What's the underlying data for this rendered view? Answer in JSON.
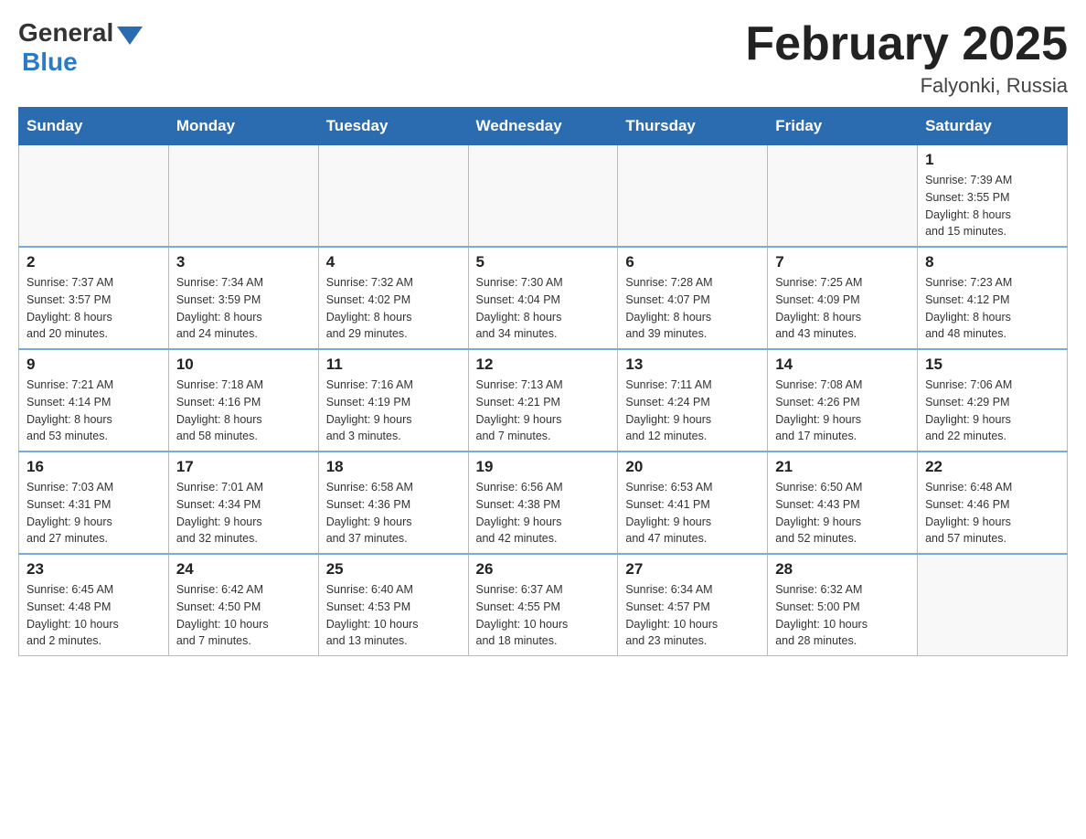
{
  "logo": {
    "general": "General",
    "blue": "Blue"
  },
  "title": "February 2025",
  "subtitle": "Falyonki, Russia",
  "weekdays": [
    "Sunday",
    "Monday",
    "Tuesday",
    "Wednesday",
    "Thursday",
    "Friday",
    "Saturday"
  ],
  "weeks": [
    [
      {
        "day": "",
        "info": ""
      },
      {
        "day": "",
        "info": ""
      },
      {
        "day": "",
        "info": ""
      },
      {
        "day": "",
        "info": ""
      },
      {
        "day": "",
        "info": ""
      },
      {
        "day": "",
        "info": ""
      },
      {
        "day": "1",
        "info": "Sunrise: 7:39 AM\nSunset: 3:55 PM\nDaylight: 8 hours\nand 15 minutes."
      }
    ],
    [
      {
        "day": "2",
        "info": "Sunrise: 7:37 AM\nSunset: 3:57 PM\nDaylight: 8 hours\nand 20 minutes."
      },
      {
        "day": "3",
        "info": "Sunrise: 7:34 AM\nSunset: 3:59 PM\nDaylight: 8 hours\nand 24 minutes."
      },
      {
        "day": "4",
        "info": "Sunrise: 7:32 AM\nSunset: 4:02 PM\nDaylight: 8 hours\nand 29 minutes."
      },
      {
        "day": "5",
        "info": "Sunrise: 7:30 AM\nSunset: 4:04 PM\nDaylight: 8 hours\nand 34 minutes."
      },
      {
        "day": "6",
        "info": "Sunrise: 7:28 AM\nSunset: 4:07 PM\nDaylight: 8 hours\nand 39 minutes."
      },
      {
        "day": "7",
        "info": "Sunrise: 7:25 AM\nSunset: 4:09 PM\nDaylight: 8 hours\nand 43 minutes."
      },
      {
        "day": "8",
        "info": "Sunrise: 7:23 AM\nSunset: 4:12 PM\nDaylight: 8 hours\nand 48 minutes."
      }
    ],
    [
      {
        "day": "9",
        "info": "Sunrise: 7:21 AM\nSunset: 4:14 PM\nDaylight: 8 hours\nand 53 minutes."
      },
      {
        "day": "10",
        "info": "Sunrise: 7:18 AM\nSunset: 4:16 PM\nDaylight: 8 hours\nand 58 minutes."
      },
      {
        "day": "11",
        "info": "Sunrise: 7:16 AM\nSunset: 4:19 PM\nDaylight: 9 hours\nand 3 minutes."
      },
      {
        "day": "12",
        "info": "Sunrise: 7:13 AM\nSunset: 4:21 PM\nDaylight: 9 hours\nand 7 minutes."
      },
      {
        "day": "13",
        "info": "Sunrise: 7:11 AM\nSunset: 4:24 PM\nDaylight: 9 hours\nand 12 minutes."
      },
      {
        "day": "14",
        "info": "Sunrise: 7:08 AM\nSunset: 4:26 PM\nDaylight: 9 hours\nand 17 minutes."
      },
      {
        "day": "15",
        "info": "Sunrise: 7:06 AM\nSunset: 4:29 PM\nDaylight: 9 hours\nand 22 minutes."
      }
    ],
    [
      {
        "day": "16",
        "info": "Sunrise: 7:03 AM\nSunset: 4:31 PM\nDaylight: 9 hours\nand 27 minutes."
      },
      {
        "day": "17",
        "info": "Sunrise: 7:01 AM\nSunset: 4:34 PM\nDaylight: 9 hours\nand 32 minutes."
      },
      {
        "day": "18",
        "info": "Sunrise: 6:58 AM\nSunset: 4:36 PM\nDaylight: 9 hours\nand 37 minutes."
      },
      {
        "day": "19",
        "info": "Sunrise: 6:56 AM\nSunset: 4:38 PM\nDaylight: 9 hours\nand 42 minutes."
      },
      {
        "day": "20",
        "info": "Sunrise: 6:53 AM\nSunset: 4:41 PM\nDaylight: 9 hours\nand 47 minutes."
      },
      {
        "day": "21",
        "info": "Sunrise: 6:50 AM\nSunset: 4:43 PM\nDaylight: 9 hours\nand 52 minutes."
      },
      {
        "day": "22",
        "info": "Sunrise: 6:48 AM\nSunset: 4:46 PM\nDaylight: 9 hours\nand 57 minutes."
      }
    ],
    [
      {
        "day": "23",
        "info": "Sunrise: 6:45 AM\nSunset: 4:48 PM\nDaylight: 10 hours\nand 2 minutes."
      },
      {
        "day": "24",
        "info": "Sunrise: 6:42 AM\nSunset: 4:50 PM\nDaylight: 10 hours\nand 7 minutes."
      },
      {
        "day": "25",
        "info": "Sunrise: 6:40 AM\nSunset: 4:53 PM\nDaylight: 10 hours\nand 13 minutes."
      },
      {
        "day": "26",
        "info": "Sunrise: 6:37 AM\nSunset: 4:55 PM\nDaylight: 10 hours\nand 18 minutes."
      },
      {
        "day": "27",
        "info": "Sunrise: 6:34 AM\nSunset: 4:57 PM\nDaylight: 10 hours\nand 23 minutes."
      },
      {
        "day": "28",
        "info": "Sunrise: 6:32 AM\nSunset: 5:00 PM\nDaylight: 10 hours\nand 28 minutes."
      },
      {
        "day": "",
        "info": ""
      }
    ]
  ]
}
